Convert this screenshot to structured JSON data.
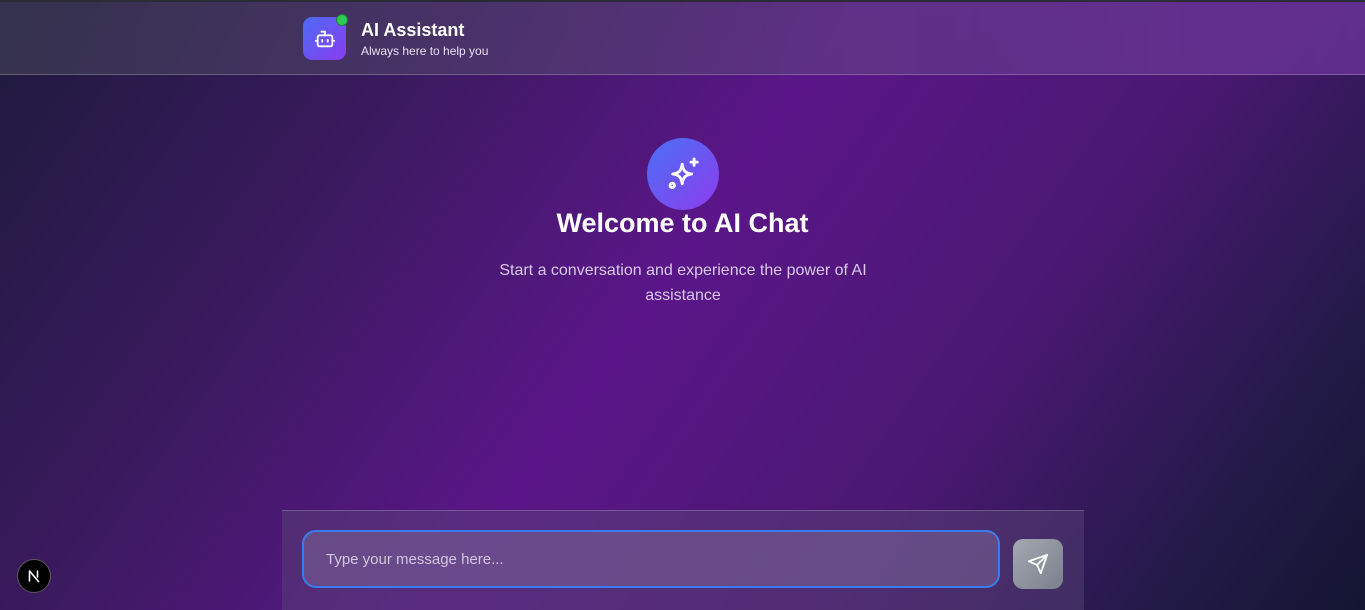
{
  "header": {
    "title": "AI Assistant",
    "subtitle": "Always here to help you",
    "logo_icon": "robot-icon",
    "status": "online"
  },
  "welcome": {
    "icon": "sparkles-icon",
    "title": "Welcome to AI Chat",
    "subtitle": "Start a conversation and experience the power of AI assistance"
  },
  "composer": {
    "placeholder": "Type your message here...",
    "value": "",
    "send_icon": "send-icon"
  },
  "dev_badge": {
    "icon": "nextjs-n-icon"
  },
  "colors": {
    "accent_blue": "#3b7bf0",
    "accent_purple": "#8a3cf0",
    "status_green": "#2ecc52"
  }
}
